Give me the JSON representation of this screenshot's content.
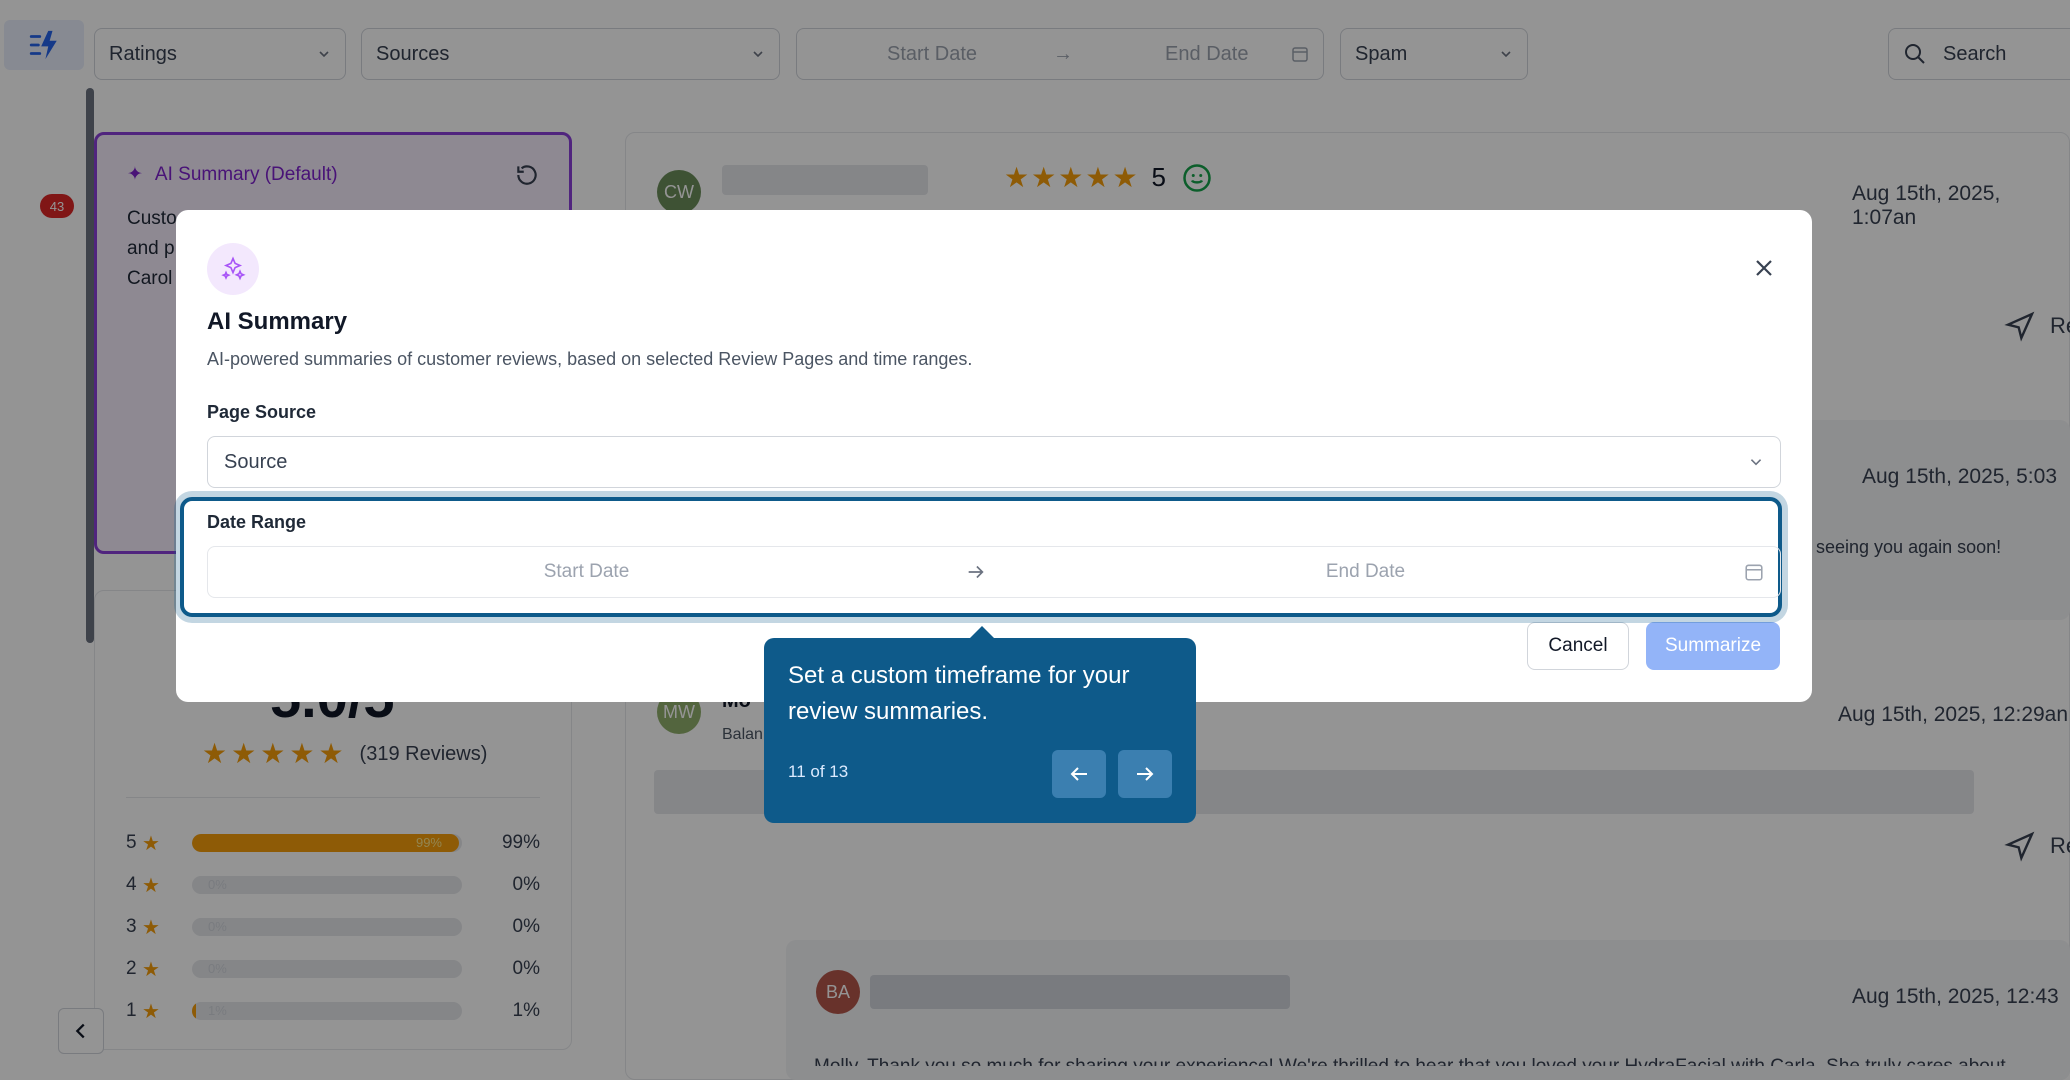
{
  "filters": {
    "ratings": "Ratings",
    "sources": "Sources",
    "start_date": "Start Date",
    "end_date": "End Date",
    "spam": "Spam",
    "search": "Search"
  },
  "sidebar": {
    "badge_count": "43"
  },
  "ai_card": {
    "title": "AI Summary (Default)",
    "text_lines": [
      "Custo",
      "and p",
      "Carol"
    ]
  },
  "rating_summary": {
    "score": "5.0/5",
    "reviews_label": "(319 Reviews)",
    "distribution": [
      {
        "stars": "5",
        "percent": 99,
        "bar_label": "99%",
        "label": "99%"
      },
      {
        "stars": "4",
        "percent": 0,
        "bar_label": "0%",
        "label": "0%"
      },
      {
        "stars": "3",
        "percent": 0,
        "bar_label": "0%",
        "label": "0%"
      },
      {
        "stars": "2",
        "percent": 0,
        "bar_label": "0%",
        "label": "0%"
      },
      {
        "stars": "1",
        "percent": 1,
        "bar_label": "1%",
        "label": "1%"
      }
    ]
  },
  "reviews": [
    {
      "initials": "CW",
      "rating": "5",
      "date": "Aug 15th, 2025, 1:07an",
      "avatar_color": "#6b8e5a"
    },
    {
      "date": "Aug 15th, 2025, 5:03",
      "snippet": "seeing you again soon!"
    },
    {
      "initials": "MW",
      "name_fragment": "Mo",
      "sub_fragment": "Balan",
      "date": "Aug 15th, 2025, 12:29an",
      "avatar_color": "#8fae6b"
    },
    {
      "initials": "BA",
      "date": "Aug 15th, 2025, 12:43",
      "avatar_color": "#b4564a",
      "snippet": "Molly, Thank you so much for sharing your experience! We're thrilled to hear that you loved your HydraFacial with Carla. She truly cares about"
    }
  ],
  "reply_label": "Re",
  "modal": {
    "title": "AI Summary",
    "description": "AI-powered summaries of customer reviews, based on selected Review Pages and time ranges.",
    "page_source_label": "Page Source",
    "page_source_placeholder": "Source",
    "date_range_label": "Date Range",
    "start_date_placeholder": "Start Date",
    "end_date_placeholder": "End Date",
    "cancel_label": "Cancel",
    "summarize_label": "Summarize"
  },
  "tour": {
    "text": "Set a custom timeframe for your review summaries.",
    "step": "11 of 13"
  },
  "colors": {
    "accent_purple": "#7e22ce",
    "tour_blue": "#0e5a8a",
    "summarize_disabled": "#93b4f8",
    "star": "#f59e0b",
    "badge_red": "#dc2626"
  }
}
